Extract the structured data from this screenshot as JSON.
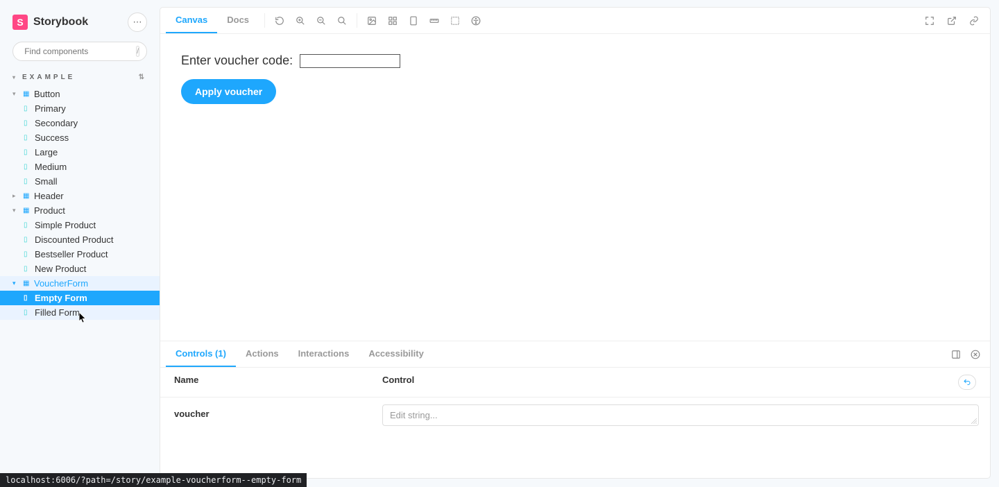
{
  "brand": {
    "logo_letter": "S",
    "logo_text": "Storybook"
  },
  "search": {
    "placeholder": "Find components",
    "shortcut": "/"
  },
  "section": {
    "heading": "Example"
  },
  "sidebar": {
    "button": {
      "label": "Button",
      "stories": [
        "Primary",
        "Secondary",
        "Success",
        "Large",
        "Medium",
        "Small"
      ]
    },
    "header": {
      "label": "Header"
    },
    "product": {
      "label": "Product",
      "stories": [
        "Simple Product",
        "Discounted Product",
        "Bestseller Product",
        "New Product"
      ]
    },
    "voucherform": {
      "label": "VoucherForm",
      "stories": [
        "Empty Form",
        "Filled Form"
      ]
    }
  },
  "toolbar": {
    "tabs": {
      "canvas": "Canvas",
      "docs": "Docs"
    }
  },
  "preview": {
    "voucher_label": "Enter voucher code:",
    "apply_button": "Apply voucher"
  },
  "addons": {
    "tabs": {
      "controls": "Controls (1)",
      "actions": "Actions",
      "interactions": "Interactions",
      "accessibility": "Accessibility"
    },
    "columns": {
      "name": "Name",
      "control": "Control"
    },
    "rows": [
      {
        "name": "voucher",
        "placeholder": "Edit string..."
      }
    ]
  },
  "status_url": "localhost:6006/?path=/story/example-voucherform--empty-form"
}
